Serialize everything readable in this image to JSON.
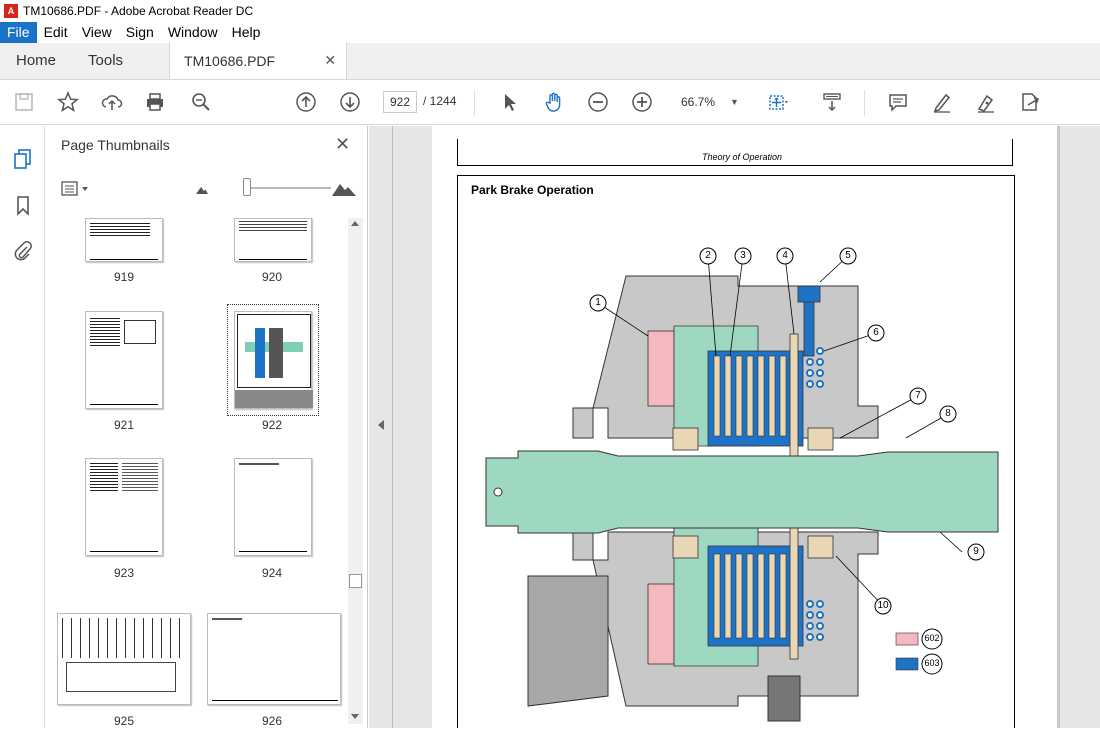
{
  "window": {
    "title": "TM10686.PDF - Adobe Acrobat Reader DC"
  },
  "menu": [
    "File",
    "Edit",
    "View",
    "Sign",
    "Window",
    "Help"
  ],
  "tabs": {
    "home": "Home",
    "tools": "Tools",
    "document": "TM10686.PDF"
  },
  "toolbar": {
    "current_page": "922",
    "total_pages": "/ 1244",
    "zoom": "66.7%"
  },
  "panel": {
    "title": "Page Thumbnails",
    "thumbnails": [
      {
        "label": "919"
      },
      {
        "label": "920"
      },
      {
        "label": "921"
      },
      {
        "label": "922",
        "selected": true
      },
      {
        "label": "923"
      },
      {
        "label": "924"
      },
      {
        "label": "925"
      },
      {
        "label": "926"
      }
    ]
  },
  "document": {
    "header": "Theory of Operation",
    "section_title": "Park Brake Operation",
    "callouts": [
      "1",
      "2",
      "3",
      "4",
      "5",
      "6",
      "7",
      "8",
      "9",
      "10"
    ],
    "legend": [
      {
        "code": "602",
        "color": "#f4b9be"
      },
      {
        "code": "603",
        "color": "#1f73c7"
      }
    ]
  },
  "colors": {
    "accent": "#1a73c9",
    "shaft": "#9fd8c0",
    "housing": "#c8c8c8",
    "friction": "#e9d6b5"
  }
}
